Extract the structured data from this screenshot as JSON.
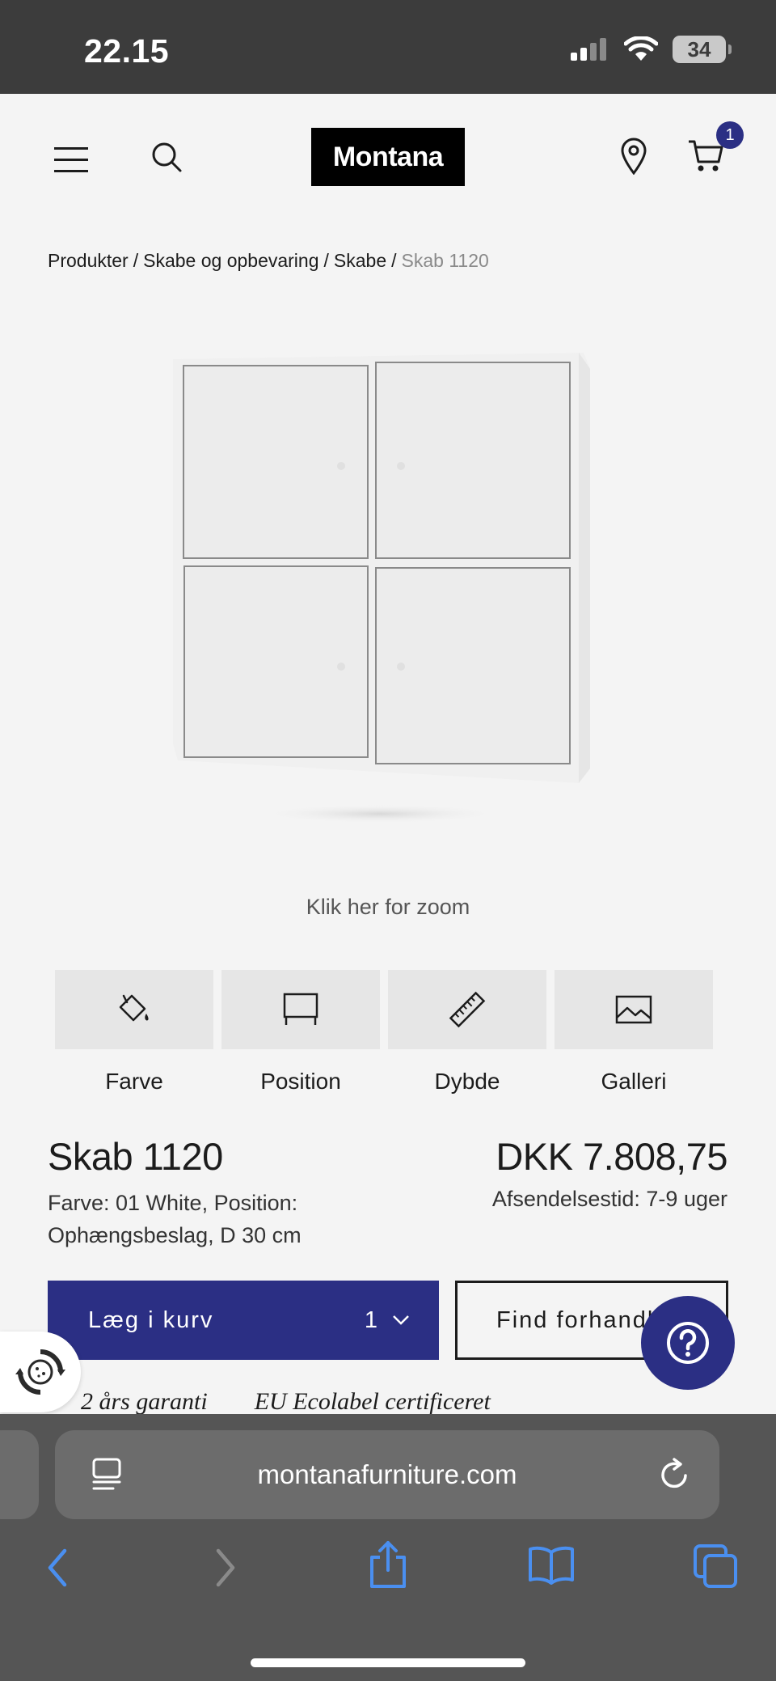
{
  "status_bar": {
    "time": "22.15",
    "battery": "34"
  },
  "header": {
    "logo": "Montana",
    "cart_count": "1"
  },
  "breadcrumb": {
    "items": [
      "Produkter",
      "Skabe og opbevaring",
      "Skabe"
    ],
    "current": "Skab 1120",
    "separator": "/"
  },
  "zoom_hint": "Klik her for zoom",
  "options": [
    {
      "label": "Farve",
      "icon": "paint-bucket-icon"
    },
    {
      "label": "Position",
      "icon": "wall-mount-icon"
    },
    {
      "label": "Dybde",
      "icon": "ruler-icon"
    },
    {
      "label": "Galleri",
      "icon": "image-icon"
    }
  ],
  "product": {
    "title": "Skab 1120",
    "price": "DKK 7.808,75",
    "variant": "Farve: 01 White, Position: Ophængsbeslag, D 30 cm",
    "shipping": "Afsendelsestid: 7-9 uger"
  },
  "actions": {
    "add_to_cart": "Læg i kurv",
    "quantity": "1",
    "find_dealer": "Find forhandler"
  },
  "badges": [
    "2 års garanti",
    "EU Ecolabel certificeret"
  ],
  "browser": {
    "url": "montanafurniture.com"
  },
  "colors": {
    "brand": "#2b2f84",
    "status_bar": "#3c3c3c",
    "chrome": "#555555",
    "ios_blue": "#4a8ff0"
  }
}
